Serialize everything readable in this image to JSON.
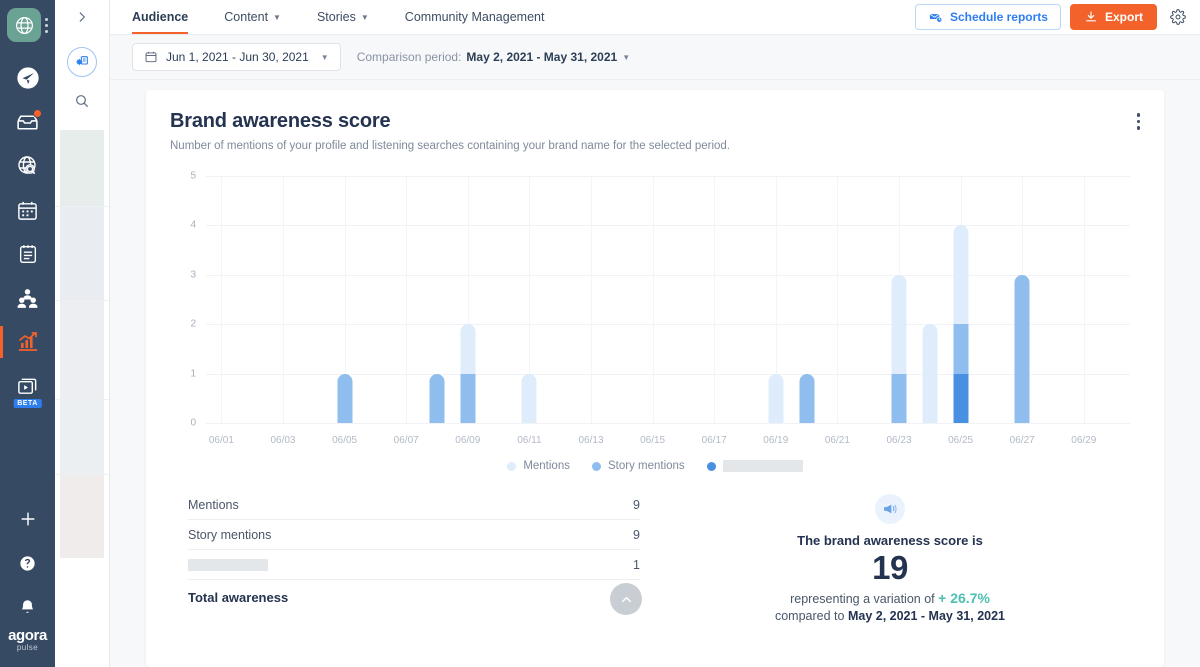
{
  "rail": {
    "avatar_icon": "globe-network-icon",
    "kebab_icon": "rail-overflow-icon",
    "items": [
      {
        "name": "publish",
        "icon": "paper-plane-icon",
        "active": false,
        "badge": false
      },
      {
        "name": "inbox",
        "icon": "inbox-icon",
        "active": false,
        "badge": true
      },
      {
        "name": "listening",
        "icon": "globe-search-icon",
        "active": false,
        "badge": false
      },
      {
        "name": "calendar",
        "icon": "calendar-icon",
        "active": false,
        "badge": false
      },
      {
        "name": "content-library",
        "icon": "notepad-icon",
        "active": false,
        "badge": false
      },
      {
        "name": "fans-followers",
        "icon": "users-icon",
        "active": false,
        "badge": false
      },
      {
        "name": "reports",
        "icon": "bar-chart-icon",
        "active": true,
        "badge": false
      },
      {
        "name": "video",
        "icon": "video-library-icon",
        "active": false,
        "badge": false,
        "tag": "BETA"
      }
    ],
    "bottom_items": [
      {
        "name": "add",
        "icon": "plus-icon"
      },
      {
        "name": "help",
        "icon": "question-circle-icon"
      },
      {
        "name": "notifications",
        "icon": "bell-icon"
      }
    ],
    "logo_line1": "agora",
    "logo_line2": "pulse"
  },
  "panel2": {
    "collapse_icon": "chevron-right-icon",
    "profiles_icon": "profiles-settings-icon",
    "search_icon": "search-icon"
  },
  "topbar": {
    "tabs": [
      {
        "label": "Audience",
        "active": true,
        "has_caret": false
      },
      {
        "label": "Content",
        "active": false,
        "has_caret": true
      },
      {
        "label": "Stories",
        "active": false,
        "has_caret": true
      },
      {
        "label": "Community Management",
        "active": false,
        "has_caret": false
      }
    ],
    "schedule_reports_label": "Schedule reports",
    "schedule_reports_icon": "envelope-clock-icon",
    "export_label": "Export",
    "export_icon": "download-icon",
    "gear_icon": "gear-icon",
    "accent_orange": "#f4622c",
    "accent_blue": "#2f7ef0"
  },
  "filterbar": {
    "calendar_icon": "calendar-icon",
    "date_range": "Jun 1, 2021 - Jun 30, 2021",
    "caret_icon": "chevron-down-icon",
    "comparison_prefix": "Comparison period:",
    "comparison_value": "May 2, 2021 - May 31, 2021"
  },
  "card": {
    "title": "Brand awareness score",
    "subtitle": "Number of mentions of your profile and listening searches containing your brand name for the selected period.",
    "menu_icon": "kebab-menu-icon"
  },
  "chart_data": {
    "type": "bar",
    "title": "Brand awareness score",
    "xlabel": "",
    "ylabel": "",
    "ylim": [
      0,
      5
    ],
    "yticks": [
      0,
      1,
      2,
      3,
      4,
      5
    ],
    "grid": true,
    "stacked": true,
    "legend_position": "bottom",
    "x": [
      "06/01",
      "06/02",
      "06/03",
      "06/04",
      "06/05",
      "06/06",
      "06/07",
      "06/08",
      "06/09",
      "06/10",
      "06/11",
      "06/12",
      "06/13",
      "06/14",
      "06/15",
      "06/16",
      "06/17",
      "06/18",
      "06/19",
      "06/20",
      "06/21",
      "06/22",
      "06/23",
      "06/24",
      "06/25",
      "06/26",
      "06/27",
      "06/28",
      "06/29",
      "06/30"
    ],
    "xticks": [
      "06/01",
      "06/03",
      "06/05",
      "06/07",
      "06/09",
      "06/11",
      "06/13",
      "06/15",
      "06/17",
      "06/19",
      "06/21",
      "06/23",
      "06/25",
      "06/27",
      "06/29"
    ],
    "series": [
      {
        "name": "Mentions",
        "color": "#dfecfb",
        "values": [
          0,
          0,
          0,
          0,
          0,
          0,
          0,
          0,
          1,
          0,
          1,
          0,
          0,
          0,
          0,
          0,
          0,
          0,
          1,
          0,
          0,
          0,
          2,
          2,
          2,
          0,
          0,
          0,
          0,
          0
        ]
      },
      {
        "name": "Story mentions",
        "color": "#8fbdee",
        "values": [
          0,
          0,
          0,
          0,
          1,
          0,
          0,
          1,
          1,
          0,
          0,
          0,
          0,
          0,
          0,
          0,
          0,
          0,
          0,
          1,
          0,
          0,
          1,
          0,
          1,
          0,
          3,
          0,
          0,
          0
        ]
      },
      {
        "name": "",
        "redacted": true,
        "color": "#4a90e2",
        "values": [
          0,
          0,
          0,
          0,
          0,
          0,
          0,
          0,
          0,
          0,
          0,
          0,
          0,
          0,
          0,
          0,
          0,
          0,
          0,
          0,
          0,
          0,
          0,
          0,
          1,
          0,
          0,
          0,
          0,
          0
        ]
      }
    ]
  },
  "table": {
    "rows": [
      {
        "label": "Mentions",
        "value": "9",
        "redacted": false,
        "total": false
      },
      {
        "label": "Story mentions",
        "value": "9",
        "redacted": false,
        "total": false
      },
      {
        "label": "",
        "value": "1",
        "redacted": true,
        "total": false
      },
      {
        "label": "Total awareness",
        "value": "19",
        "redacted": false,
        "total": true
      }
    ]
  },
  "summary": {
    "icon": "megaphone-icon",
    "line1": "The brand awareness score is",
    "score": "19",
    "variation_prefix": "representing a variation of",
    "variation_value": "+ 26.7%",
    "variation_color": "#4bbfb0",
    "compare_prefix": "compared to",
    "compare_value": "May 2, 2021 - May 31, 2021",
    "scroll_top_icon": "chevron-up-icon"
  }
}
